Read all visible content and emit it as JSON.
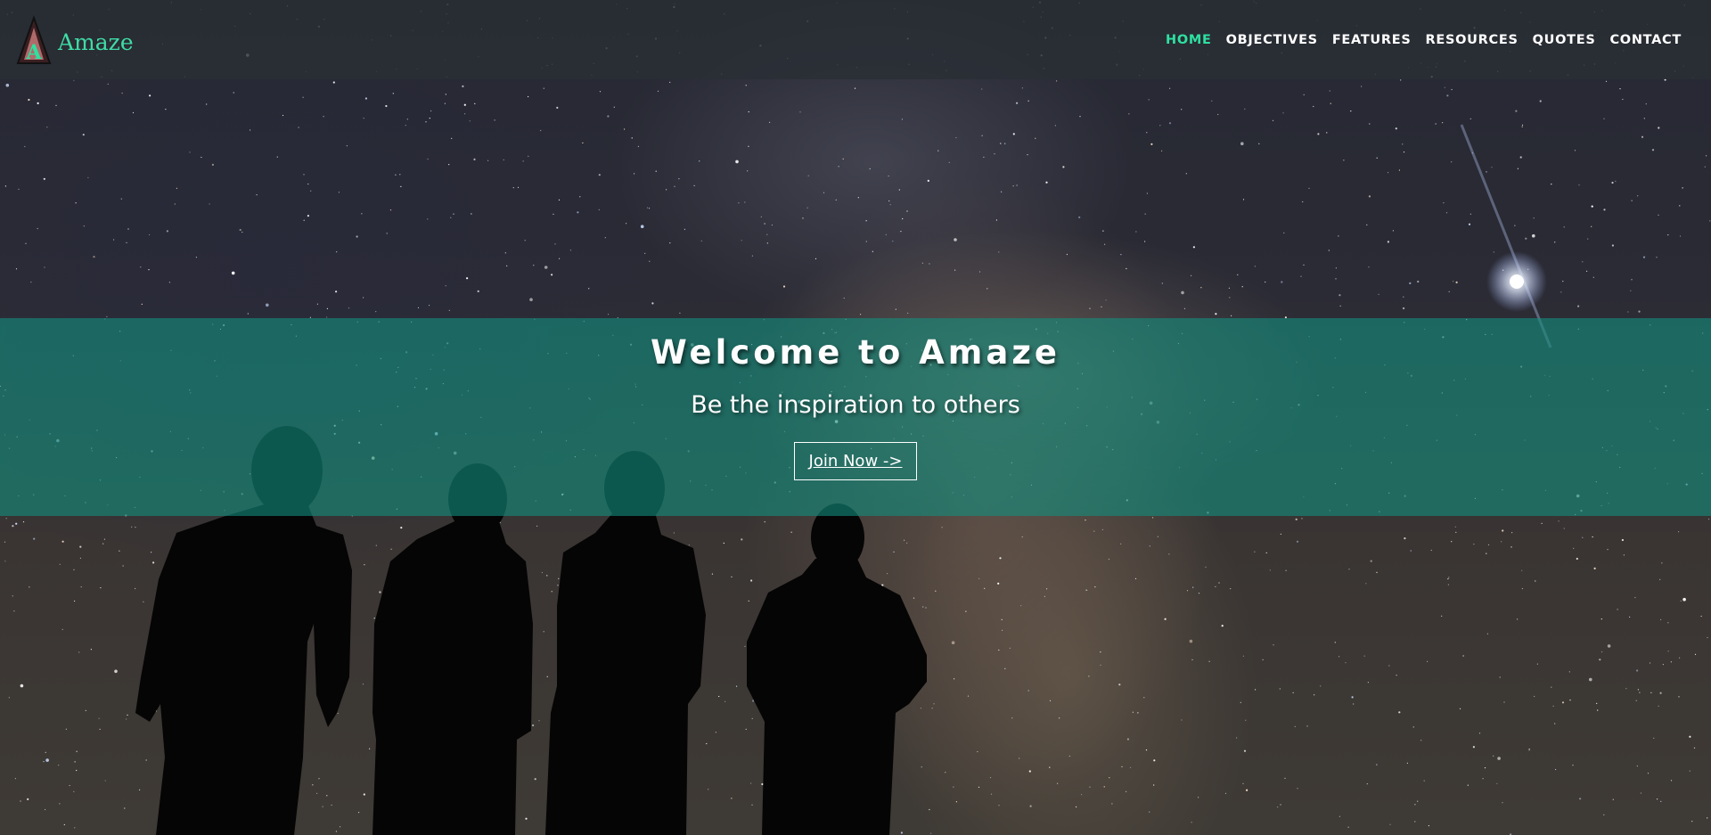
{
  "header": {
    "brand_letter": "A",
    "brand_name": "Amaze",
    "nav": [
      {
        "label": "HOME",
        "active": true
      },
      {
        "label": "OBJECTIVES",
        "active": false
      },
      {
        "label": "FEATURES",
        "active": false
      },
      {
        "label": "RESOURCES",
        "active": false
      },
      {
        "label": "QUOTES",
        "active": false
      },
      {
        "label": "CONTACT",
        "active": false
      }
    ]
  },
  "hero": {
    "title": "Welcome to Amaze",
    "subtitle": "Be the inspiration to others",
    "button_label": "Join Now ->"
  },
  "colors": {
    "accent": "#2ee0a0",
    "brand": "#3fdca6",
    "navbar_bg": "#2a2e34",
    "hero_band": "#148c7d",
    "text": "#ffffff"
  },
  "icons": {
    "logo": "triangle-a-logo-icon"
  }
}
